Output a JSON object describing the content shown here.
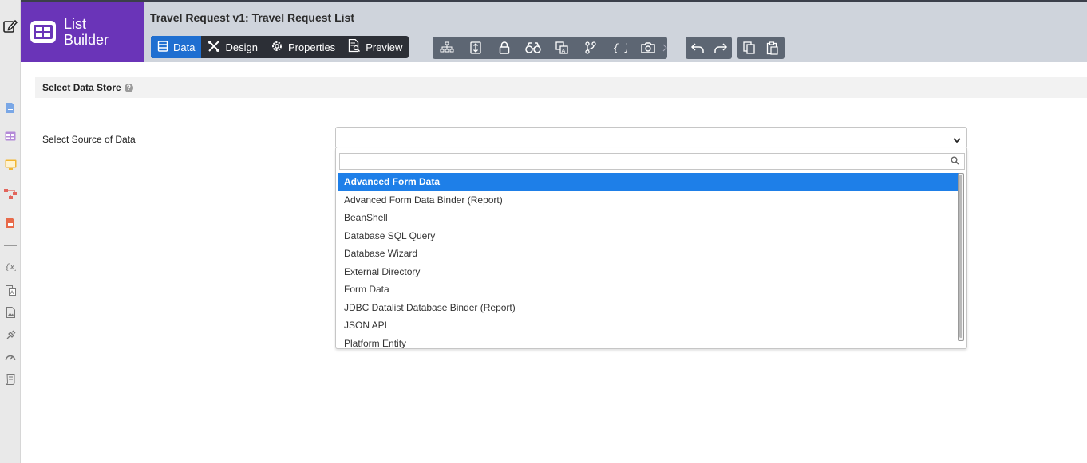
{
  "brand": {
    "line1": "List",
    "line2": "Builder"
  },
  "header": {
    "title": "Travel Request v1: Travel Request List"
  },
  "tabs": [
    {
      "label": "Data",
      "icon": "data-icon",
      "active": true
    },
    {
      "label": "Design",
      "icon": "design-icon",
      "active": false
    },
    {
      "label": "Properties",
      "icon": "gear-icon",
      "active": false
    },
    {
      "label": "Preview",
      "icon": "preview-icon",
      "active": false
    }
  ],
  "toolbar": {
    "tools": [
      "tree-icon",
      "sort-icon",
      "lock-icon",
      "binoculars-icon",
      "translate-icon",
      "branch-icon",
      "braces-icon",
      "camera-icon"
    ],
    "history": [
      "undo-icon",
      "redo-icon"
    ],
    "clipboard": [
      "copy-icon",
      "paste-icon"
    ]
  },
  "section": {
    "title": "Select Data Store"
  },
  "form": {
    "source_label": "Select Source of Data",
    "search_placeholder": "",
    "options": [
      "Advanced Form Data",
      "Advanced Form Data Binder (Report)",
      "BeanShell",
      "Database SQL Query",
      "Database Wizard",
      "External Directory",
      "Form Data",
      "JDBC Datalist Database Binder (Report)",
      "JSON API",
      "Platform Entity"
    ],
    "selected_index": 0
  },
  "colors": {
    "brand": "#6a34b8",
    "active_tab": "#1f6fd1",
    "selected_option": "#1e7fe8"
  }
}
